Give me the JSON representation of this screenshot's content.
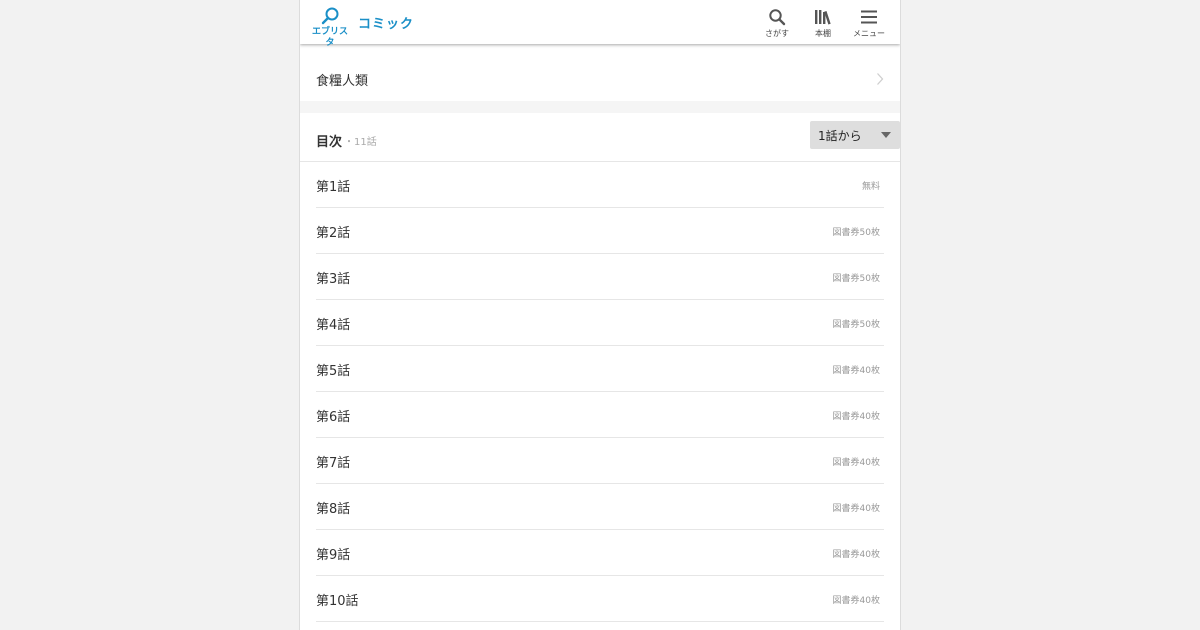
{
  "header": {
    "logo_text": "エブリスタ",
    "section_title": "コミック",
    "search_label": "さがす",
    "bookshelf_label": "本棚",
    "menu_label": "メニュー"
  },
  "work": {
    "title": "食糧人類"
  },
  "toc": {
    "label": "目次",
    "count": "・11話",
    "sort_selected": "1話から"
  },
  "episodes": [
    {
      "title": "第1話",
      "price": "無料"
    },
    {
      "title": "第2話",
      "price": "図書券50枚"
    },
    {
      "title": "第3話",
      "price": "図書券50枚"
    },
    {
      "title": "第4話",
      "price": "図書券50枚"
    },
    {
      "title": "第5話",
      "price": "図書券40枚"
    },
    {
      "title": "第6話",
      "price": "図書券40枚"
    },
    {
      "title": "第7話",
      "price": "図書券40枚"
    },
    {
      "title": "第8話",
      "price": "図書券40枚"
    },
    {
      "title": "第9話",
      "price": "図書券40枚"
    },
    {
      "title": "第10話",
      "price": "図書券40枚"
    }
  ],
  "colors": {
    "brand": "#1a8fc7",
    "background": "#f2f2f2",
    "text": "#333333",
    "muted": "#999999"
  },
  "icons": {
    "logo": "magnifier-logo-icon",
    "search": "search-icon",
    "bookshelf": "bookshelf-icon",
    "menu": "hamburger-menu-icon",
    "chevron": "chevron-right-icon",
    "sort": "caret-down-icon"
  }
}
